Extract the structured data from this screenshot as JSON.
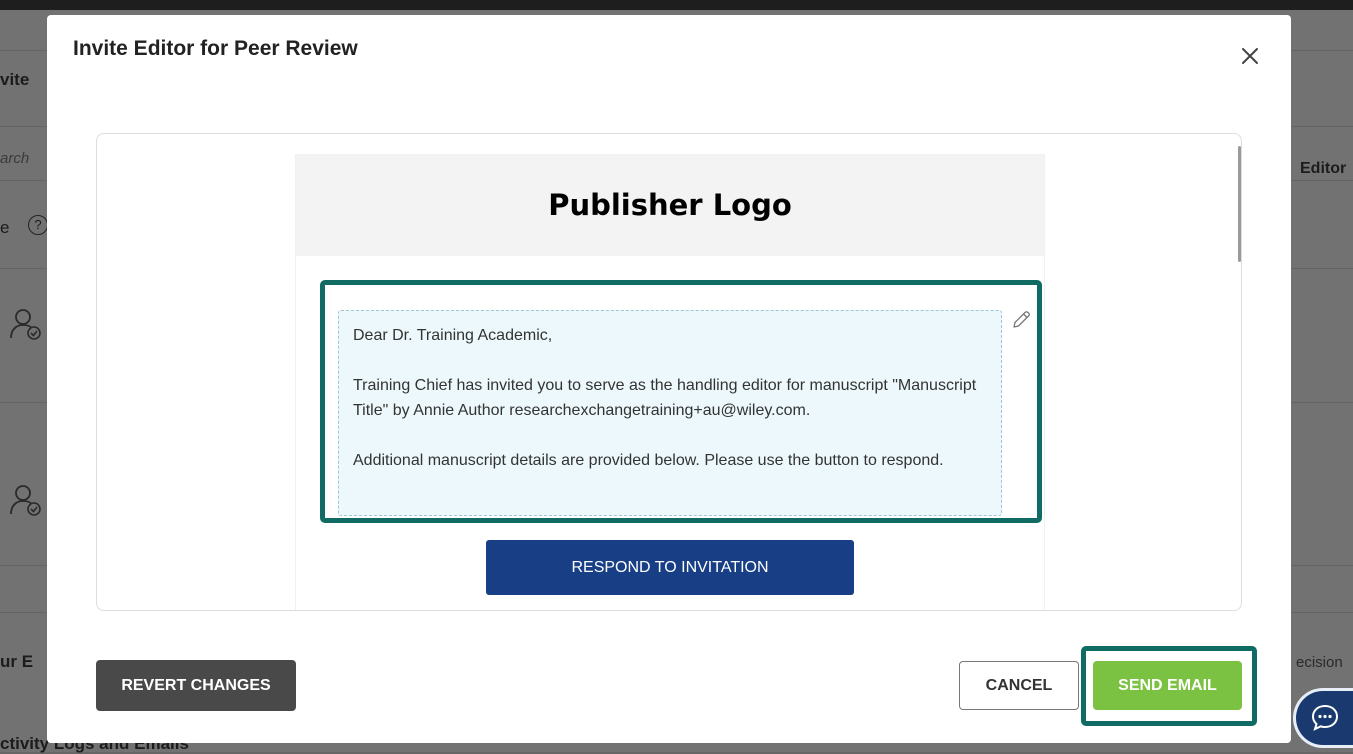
{
  "background": {
    "frag_invite": "vite",
    "frag_search": "arch",
    "frag_editor": "Editor",
    "frag_e": "e",
    "frag_help": "?",
    "frag_our": "ur E",
    "frag_decision": "ecision",
    "frag_activity": "ctivity Logs and Emails"
  },
  "modal": {
    "title": "Invite Editor for Peer Review",
    "close_icon": "close-icon"
  },
  "email": {
    "logo_text": "Publisher Logo",
    "greeting": "Dear Dr. Training Academic,",
    "paragraph1": "Training Chief has invited you to serve as the handling editor for manuscript \"Manuscript Title\" by Annie Author researchexchangetraining+au@wiley.com.",
    "paragraph2": "Additional manuscript details are provided below. Please use the button to respond.",
    "respond_label": "RESPOND TO INVITATION",
    "edit_icon": "pencil-icon"
  },
  "footer": {
    "revert_label": "REVERT CHANGES",
    "cancel_label": "CANCEL",
    "send_label": "SEND EMAIL"
  },
  "colors": {
    "highlight": "#0f6b63",
    "respond_button": "#183f86",
    "send_button": "#7cc242",
    "revert_button": "#494949"
  },
  "chat_icon": "chat-bubble-icon"
}
